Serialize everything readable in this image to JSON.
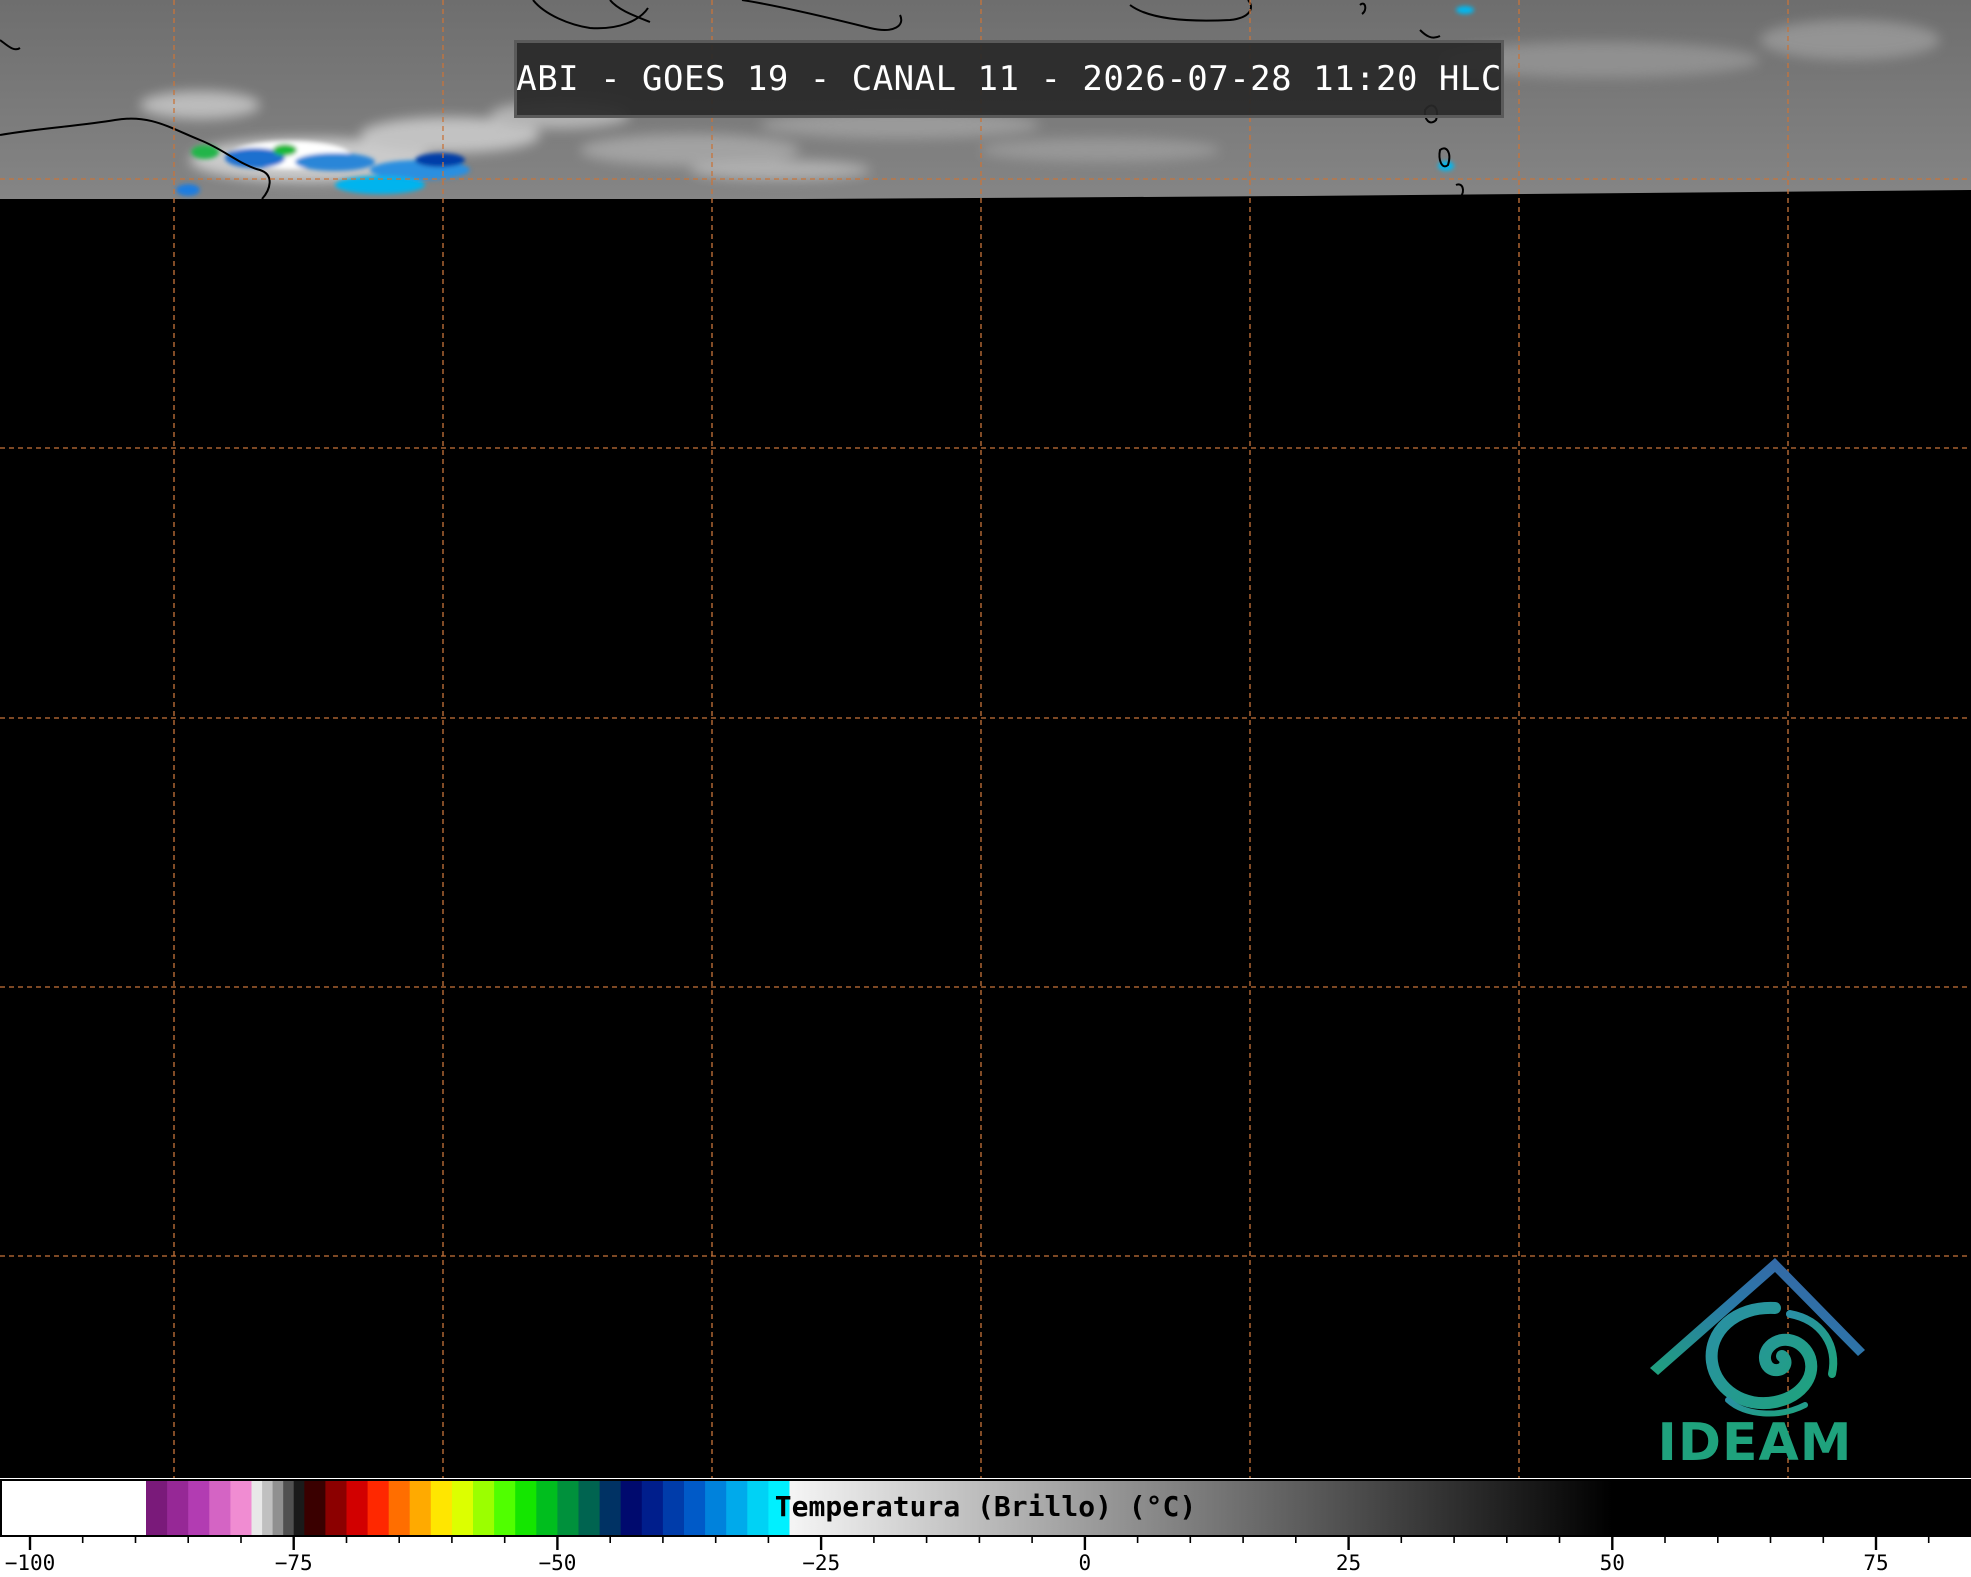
{
  "header": {
    "title": "ABI - GOES 19 - CANAL 11 - 2026-07-28 11:20 HLC"
  },
  "map": {
    "background_color": "#000000",
    "cloud_band_color": "#7a7a7a",
    "graticule_color": "#c8743a",
    "graticule_style": "dashed",
    "coastline_color": "#000000"
  },
  "logo": {
    "text": "IDEAM",
    "icon": "ideam-swirl-roof-icon",
    "text_color": "#1fa27d",
    "roof_color": "#2f6fa8"
  },
  "colorbar": {
    "label": "Temperatura (Brillo) (°C)",
    "range": [
      -103,
      84
    ],
    "ticks": [
      {
        "value": -100,
        "label": "−100"
      },
      {
        "value": -75,
        "label": "−75"
      },
      {
        "value": -50,
        "label": "−50"
      },
      {
        "value": -25,
        "label": "−25"
      },
      {
        "value": 0,
        "label": "0"
      },
      {
        "value": 25,
        "label": "25"
      },
      {
        "value": 50,
        "label": "50"
      },
      {
        "value": 75,
        "label": "75"
      }
    ],
    "segments": [
      {
        "from": -103,
        "to": -89,
        "color": "#ffffff"
      },
      {
        "from": -89,
        "to": -87,
        "color": "#7a1a7a"
      },
      {
        "from": -87,
        "to": -85,
        "color": "#962896"
      },
      {
        "from": -85,
        "to": -83,
        "color": "#b23cb2"
      },
      {
        "from": -83,
        "to": -81,
        "color": "#d464c4"
      },
      {
        "from": -81,
        "to": -79,
        "color": "#f08cd2"
      },
      {
        "from": -79,
        "to": -78,
        "color": "#e8e8e8"
      },
      {
        "from": -78,
        "to": -77,
        "color": "#c0c0c0"
      },
      {
        "from": -77,
        "to": -76,
        "color": "#909090"
      },
      {
        "from": -76,
        "to": -75,
        "color": "#505050"
      },
      {
        "from": -75,
        "to": -74,
        "color": "#1a1a1a"
      },
      {
        "from": -74,
        "to": -72,
        "color": "#3a0000"
      },
      {
        "from": -72,
        "to": -70,
        "color": "#8c0000"
      },
      {
        "from": -70,
        "to": -68,
        "color": "#d20000"
      },
      {
        "from": -68,
        "to": -66,
        "color": "#ff2800"
      },
      {
        "from": -66,
        "to": -64,
        "color": "#ff6e00"
      },
      {
        "from": -64,
        "to": -62,
        "color": "#ffaa00"
      },
      {
        "from": -62,
        "to": -60,
        "color": "#ffe600"
      },
      {
        "from": -60,
        "to": -58,
        "color": "#dcff00"
      },
      {
        "from": -58,
        "to": -56,
        "color": "#9bff00"
      },
      {
        "from": -56,
        "to": -54,
        "color": "#50ff00"
      },
      {
        "from": -54,
        "to": -52,
        "color": "#14e600"
      },
      {
        "from": -52,
        "to": -50,
        "color": "#00be1e"
      },
      {
        "from": -50,
        "to": -48,
        "color": "#00913c"
      },
      {
        "from": -48,
        "to": -46,
        "color": "#006450"
      },
      {
        "from": -46,
        "to": -44,
        "color": "#003264"
      },
      {
        "from": -44,
        "to": -42,
        "color": "#000a6e"
      },
      {
        "from": -42,
        "to": -40,
        "color": "#001e8c"
      },
      {
        "from": -40,
        "to": -38,
        "color": "#003caa"
      },
      {
        "from": -38,
        "to": -36,
        "color": "#005ac8"
      },
      {
        "from": -36,
        "to": -34,
        "color": "#0082dc"
      },
      {
        "from": -34,
        "to": -32,
        "color": "#00aaeb"
      },
      {
        "from": -32,
        "to": -30,
        "color": "#00d2f5"
      },
      {
        "from": -30,
        "to": -28,
        "color": "#00f0ff"
      },
      {
        "from": -28,
        "to": 50,
        "gradient": [
          "#f5f5f5",
          "#000000"
        ]
      },
      {
        "from": 50,
        "to": 84,
        "color": "#000000"
      }
    ]
  }
}
